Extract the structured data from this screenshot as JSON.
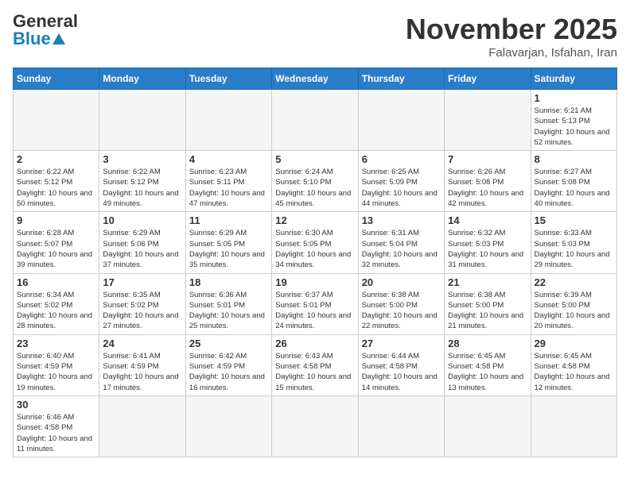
{
  "header": {
    "logo_general": "General",
    "logo_blue": "Blue",
    "month": "November 2025",
    "location": "Falavarjan, Isfahan, Iran"
  },
  "days_of_week": [
    "Sunday",
    "Monday",
    "Tuesday",
    "Wednesday",
    "Thursday",
    "Friday",
    "Saturday"
  ],
  "weeks": [
    [
      {
        "day": "",
        "info": ""
      },
      {
        "day": "",
        "info": ""
      },
      {
        "day": "",
        "info": ""
      },
      {
        "day": "",
        "info": ""
      },
      {
        "day": "",
        "info": ""
      },
      {
        "day": "",
        "info": ""
      },
      {
        "day": "1",
        "info": "Sunrise: 6:21 AM\nSunset: 5:13 PM\nDaylight: 10 hours and 52 minutes."
      }
    ],
    [
      {
        "day": "2",
        "info": "Sunrise: 6:22 AM\nSunset: 5:12 PM\nDaylight: 10 hours and 50 minutes."
      },
      {
        "day": "3",
        "info": "Sunrise: 6:22 AM\nSunset: 5:12 PM\nDaylight: 10 hours and 49 minutes."
      },
      {
        "day": "4",
        "info": "Sunrise: 6:23 AM\nSunset: 5:11 PM\nDaylight: 10 hours and 47 minutes."
      },
      {
        "day": "5",
        "info": "Sunrise: 6:24 AM\nSunset: 5:10 PM\nDaylight: 10 hours and 45 minutes."
      },
      {
        "day": "6",
        "info": "Sunrise: 6:25 AM\nSunset: 5:09 PM\nDaylight: 10 hours and 44 minutes."
      },
      {
        "day": "7",
        "info": "Sunrise: 6:26 AM\nSunset: 5:08 PM\nDaylight: 10 hours and 42 minutes."
      },
      {
        "day": "8",
        "info": "Sunrise: 6:27 AM\nSunset: 5:08 PM\nDaylight: 10 hours and 40 minutes."
      }
    ],
    [
      {
        "day": "9",
        "info": "Sunrise: 6:28 AM\nSunset: 5:07 PM\nDaylight: 10 hours and 39 minutes."
      },
      {
        "day": "10",
        "info": "Sunrise: 6:29 AM\nSunset: 5:06 PM\nDaylight: 10 hours and 37 minutes."
      },
      {
        "day": "11",
        "info": "Sunrise: 6:29 AM\nSunset: 5:05 PM\nDaylight: 10 hours and 35 minutes."
      },
      {
        "day": "12",
        "info": "Sunrise: 6:30 AM\nSunset: 5:05 PM\nDaylight: 10 hours and 34 minutes."
      },
      {
        "day": "13",
        "info": "Sunrise: 6:31 AM\nSunset: 5:04 PM\nDaylight: 10 hours and 32 minutes."
      },
      {
        "day": "14",
        "info": "Sunrise: 6:32 AM\nSunset: 5:03 PM\nDaylight: 10 hours and 31 minutes."
      },
      {
        "day": "15",
        "info": "Sunrise: 6:33 AM\nSunset: 5:03 PM\nDaylight: 10 hours and 29 minutes."
      }
    ],
    [
      {
        "day": "16",
        "info": "Sunrise: 6:34 AM\nSunset: 5:02 PM\nDaylight: 10 hours and 28 minutes."
      },
      {
        "day": "17",
        "info": "Sunrise: 6:35 AM\nSunset: 5:02 PM\nDaylight: 10 hours and 27 minutes."
      },
      {
        "day": "18",
        "info": "Sunrise: 6:36 AM\nSunset: 5:01 PM\nDaylight: 10 hours and 25 minutes."
      },
      {
        "day": "19",
        "info": "Sunrise: 6:37 AM\nSunset: 5:01 PM\nDaylight: 10 hours and 24 minutes."
      },
      {
        "day": "20",
        "info": "Sunrise: 6:38 AM\nSunset: 5:00 PM\nDaylight: 10 hours and 22 minutes."
      },
      {
        "day": "21",
        "info": "Sunrise: 6:38 AM\nSunset: 5:00 PM\nDaylight: 10 hours and 21 minutes."
      },
      {
        "day": "22",
        "info": "Sunrise: 6:39 AM\nSunset: 5:00 PM\nDaylight: 10 hours and 20 minutes."
      }
    ],
    [
      {
        "day": "23",
        "info": "Sunrise: 6:40 AM\nSunset: 4:59 PM\nDaylight: 10 hours and 19 minutes."
      },
      {
        "day": "24",
        "info": "Sunrise: 6:41 AM\nSunset: 4:59 PM\nDaylight: 10 hours and 17 minutes."
      },
      {
        "day": "25",
        "info": "Sunrise: 6:42 AM\nSunset: 4:59 PM\nDaylight: 10 hours and 16 minutes."
      },
      {
        "day": "26",
        "info": "Sunrise: 6:43 AM\nSunset: 4:58 PM\nDaylight: 10 hours and 15 minutes."
      },
      {
        "day": "27",
        "info": "Sunrise: 6:44 AM\nSunset: 4:58 PM\nDaylight: 10 hours and 14 minutes."
      },
      {
        "day": "28",
        "info": "Sunrise: 6:45 AM\nSunset: 4:58 PM\nDaylight: 10 hours and 13 minutes."
      },
      {
        "day": "29",
        "info": "Sunrise: 6:45 AM\nSunset: 4:58 PM\nDaylight: 10 hours and 12 minutes."
      }
    ],
    [
      {
        "day": "30",
        "info": "Sunrise: 6:46 AM\nSunset: 4:58 PM\nDaylight: 10 hours and 11 minutes."
      },
      {
        "day": "",
        "info": ""
      },
      {
        "day": "",
        "info": ""
      },
      {
        "day": "",
        "info": ""
      },
      {
        "day": "",
        "info": ""
      },
      {
        "day": "",
        "info": ""
      },
      {
        "day": "",
        "info": ""
      }
    ]
  ]
}
